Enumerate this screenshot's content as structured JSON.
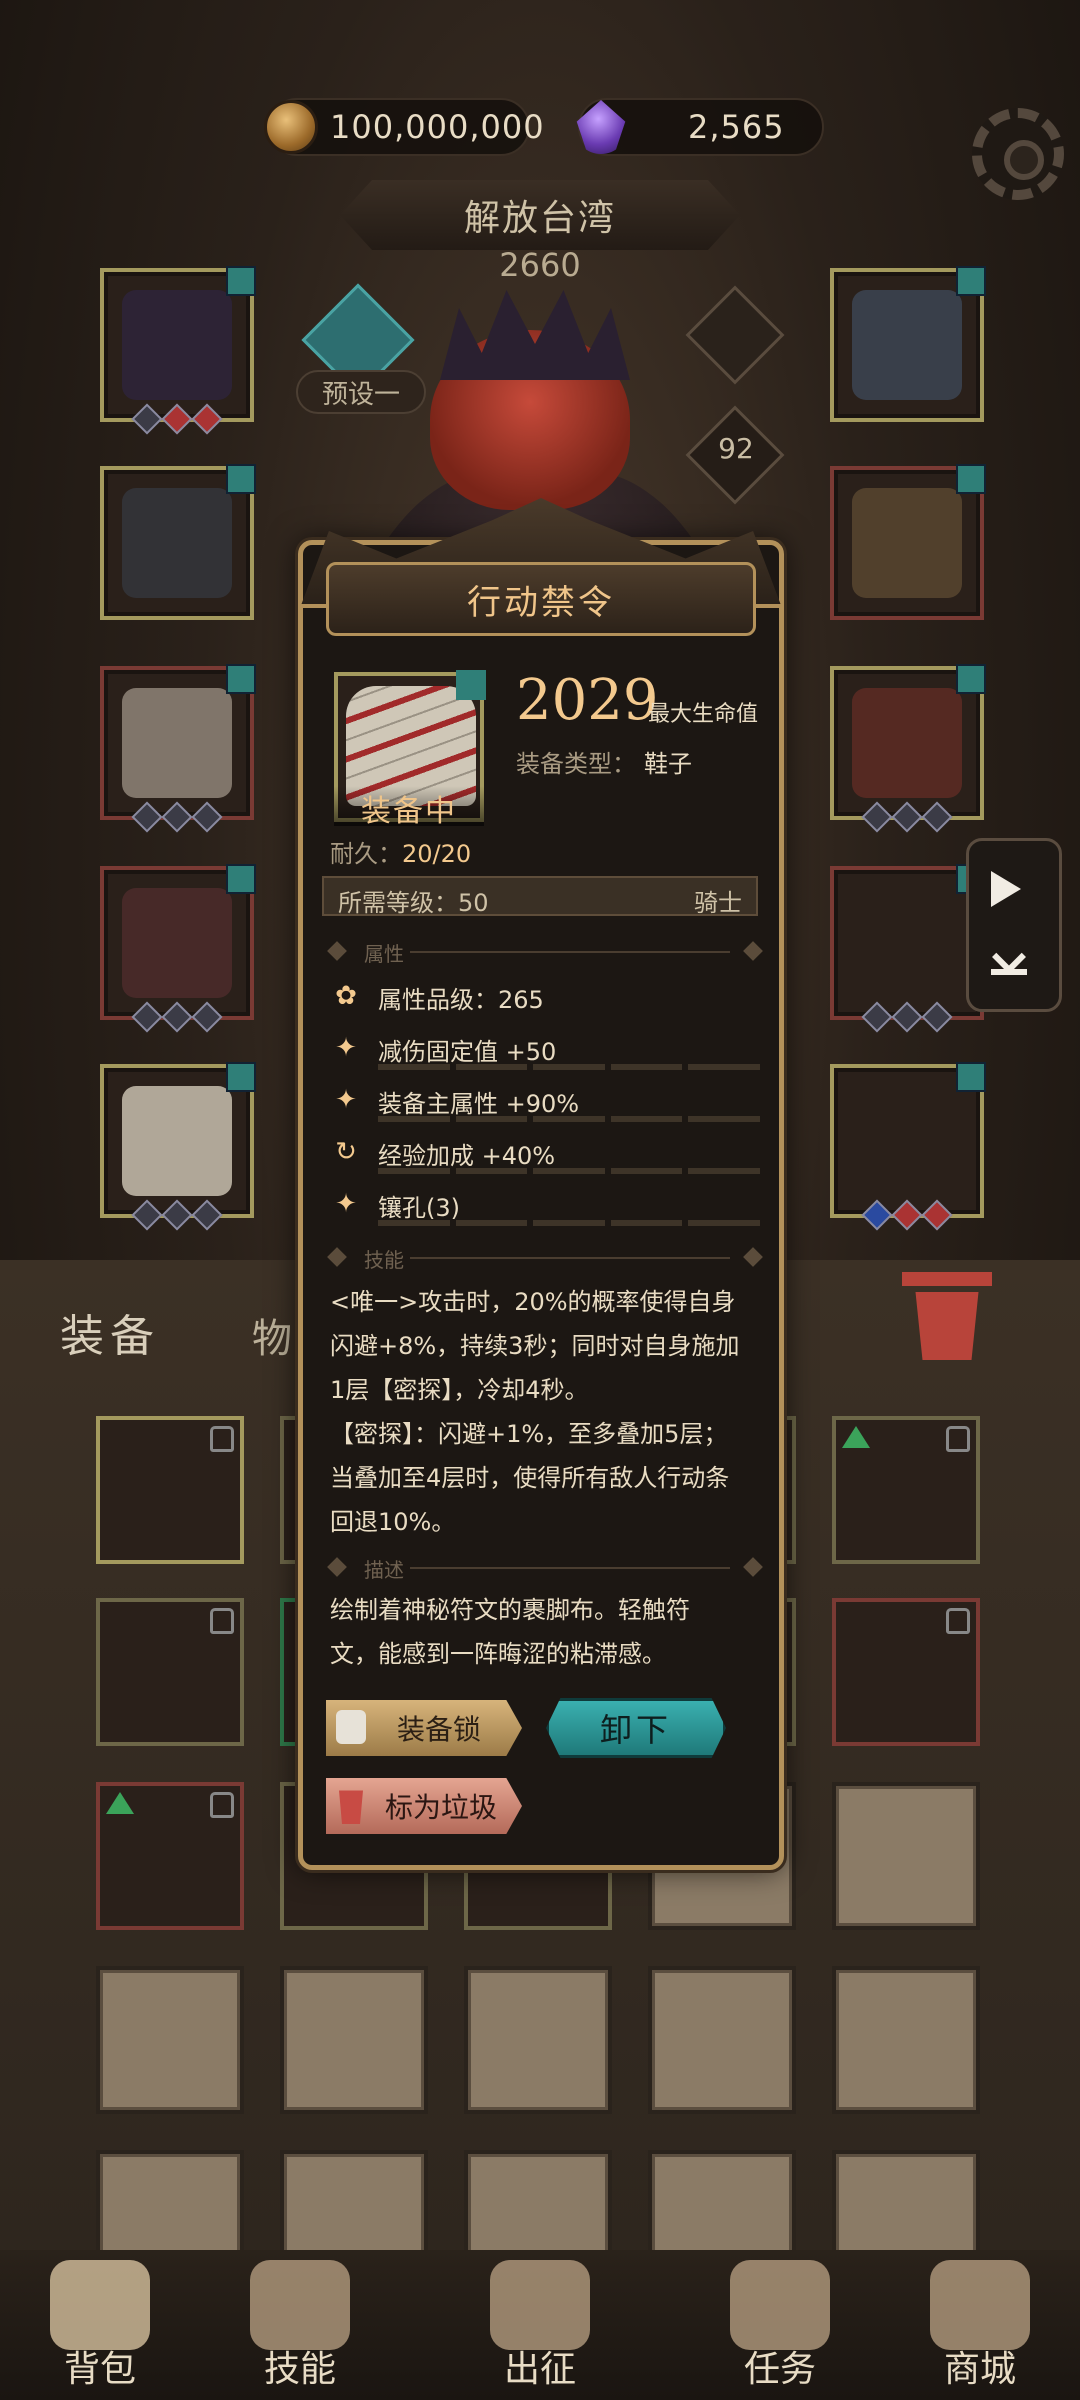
{
  "currencies": {
    "gold": "100,000,000",
    "gems": "2,565"
  },
  "header": {
    "title": "解放台湾",
    "score": "2660",
    "preset_label": "预设一",
    "level": "92"
  },
  "side_drawer": {
    "play_label": "开始",
    "collapse_label": "展开"
  },
  "inventory": {
    "tabs": [
      "装备",
      "物品"
    ]
  },
  "bottom_nav": [
    {
      "label": "背包",
      "icon": "backpack-icon"
    },
    {
      "label": "技能",
      "icon": "skill-icon"
    },
    {
      "label": "出征",
      "icon": "sword-icon"
    },
    {
      "label": "任务",
      "icon": "scroll-icon"
    },
    {
      "label": "商城",
      "icon": "shop-icon"
    }
  ],
  "item_card": {
    "title": "行动禁令",
    "power": "2029",
    "power_label": "最大生命值",
    "type_label": "装备类型：",
    "type_value": "鞋子",
    "equipped": "装备中",
    "durability_label": "耐久：",
    "durability_value": "20/20",
    "required_level": "所需等级：50",
    "class": "骑士",
    "section_attributes": "属性",
    "attr_quality": "属性品级：265",
    "attributes": [
      "减伤固定值 +50",
      "装备主属性 +90%",
      "经验加成 +40%",
      "镶孔(3)"
    ],
    "section_skill": "技能",
    "skill_text": [
      "<唯一>攻击时，20%的概率使得自身",
      "闪避+8%，持续3秒；同时对自身施加",
      "1层【密探】，冷却4秒。",
      "【密探】：闪避+1%，至多叠加5层；",
      "当叠加至4层时，使得所有敌人行动条",
      "回退10%。"
    ],
    "section_description": "描述",
    "description": [
      "绘制着神秘符文的裹脚布。轻触符",
      "文，能感到一阵晦涩的粘滞感。"
    ],
    "lock_button": "装备锁",
    "unequip_button": "卸下",
    "trash_button": "标为垃圾"
  },
  "colors": {
    "accent_gold": "#f3c98e",
    "teal_button": "#2a9a9a",
    "trash_red": "#c84b44"
  }
}
